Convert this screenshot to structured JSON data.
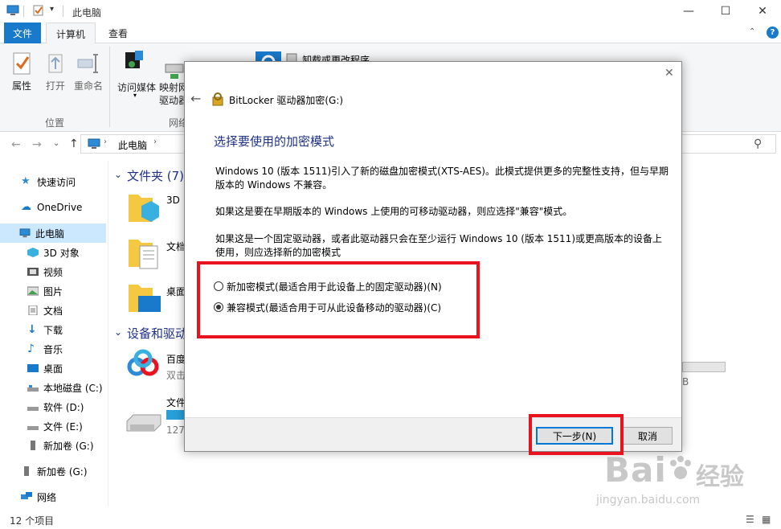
{
  "window": {
    "title": "此电脑",
    "minimize": "—",
    "maximize": "☐",
    "close": "✕"
  },
  "ribbon_tabs": {
    "file": "文件",
    "computer": "计算机",
    "view": "查看"
  },
  "ribbon": {
    "properties": "属性",
    "open": "打开",
    "rename": "重命名",
    "media_access": "访问媒体",
    "map_drive_1": "映射网",
    "map_drive_2": "驱动器",
    "uninstall": "卸载或更改程序",
    "group_location": "位置",
    "group_network": "网络"
  },
  "address": {
    "path": "此电脑"
  },
  "nav": {
    "quick_access": "快速访问",
    "onedrive": "OneDrive",
    "this_pc": "此电脑",
    "objects_3d": "3D 对象",
    "videos": "视频",
    "pictures": "图片",
    "documents": "文档",
    "downloads": "下载",
    "music": "音乐",
    "desktop": "桌面",
    "local_c": "本地磁盘 (C:)",
    "drive_d": "软件 (D:)",
    "drive_e": "文件 (E:)",
    "drive_g": "新加卷 (G:)",
    "drive_g2": "新加卷 (G:)",
    "network": "网络"
  },
  "content": {
    "folders_header": "文件夹 (7)",
    "folder_3d": "3D",
    "folder_docs": "文档",
    "folder_desktop": "桌面",
    "devices_header": "设备和驱动",
    "baidu_name": "百度",
    "baidu_sub": "双击",
    "drive_name": "文件",
    "drive_size": "127",
    "right_size": "B"
  },
  "status": {
    "items": "12 个项目"
  },
  "dialog": {
    "title": "BitLocker 驱动器加密(G:)",
    "heading": "选择要使用的加密模式",
    "para1_line1": "Windows 10 (版本 1511)引入了新的磁盘加密模式(XTS-AES)。此模式提供更多的完整性支持，但与早期",
    "para1_line2": "版本的 Windows 不兼容。",
    "para2": "如果这是要在早期版本的 Windows 上使用的可移动驱动器，则应选择\"兼容\"模式。",
    "para3_line1": "如果这是一个固定驱动器，或者此驱动器只会在至少运行 Windows 10 (版本 1511)或更高版本的设备上",
    "para3_line2": "使用，则应选择新的加密模式",
    "option_new": "新加密模式(最适合用于此设备上的固定驱动器)(N)",
    "option_compat": "兼容模式(最适合用于可从此设备移动的驱动器)(C)",
    "selected": "compat",
    "next": "下一步(N)",
    "cancel": "取消"
  },
  "watermark": {
    "brand": "Bai",
    "brand2": "经验",
    "url": "jingyan.baidu.com"
  },
  "colors": {
    "accent": "#1979ca",
    "highlight": "#e8131f",
    "heading": "#1e3287"
  }
}
